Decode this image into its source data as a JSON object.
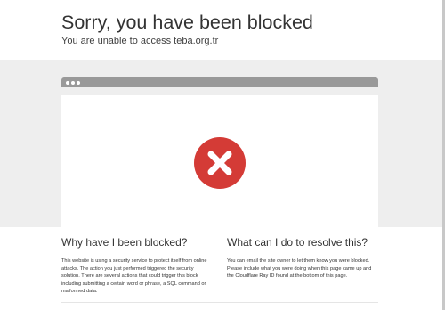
{
  "header": {
    "title": "Sorry, you have been blocked",
    "subtitle": "You are unable to access teba.org.tr"
  },
  "colors": {
    "block_icon": "#d43b36",
    "band": "#eeeeee",
    "browser_bar": "#999999"
  },
  "icons": {
    "block": "x-circle-icon",
    "window_dots": "browser-dot-icon"
  },
  "why": {
    "heading": "Why have I been blocked?",
    "body": "This website is using a security service to protect itself from online attacks. The action you just performed triggered the security solution. There are several actions that could trigger this block including submitting a certain word or phrase, a SQL command or malformed data."
  },
  "resolve": {
    "heading": "What can I do to resolve this?",
    "body": "You can email the site owner to let them know you were blocked. Please include what you were doing when this page came up and the Cloudflare Ray ID found at the bottom of this page."
  }
}
